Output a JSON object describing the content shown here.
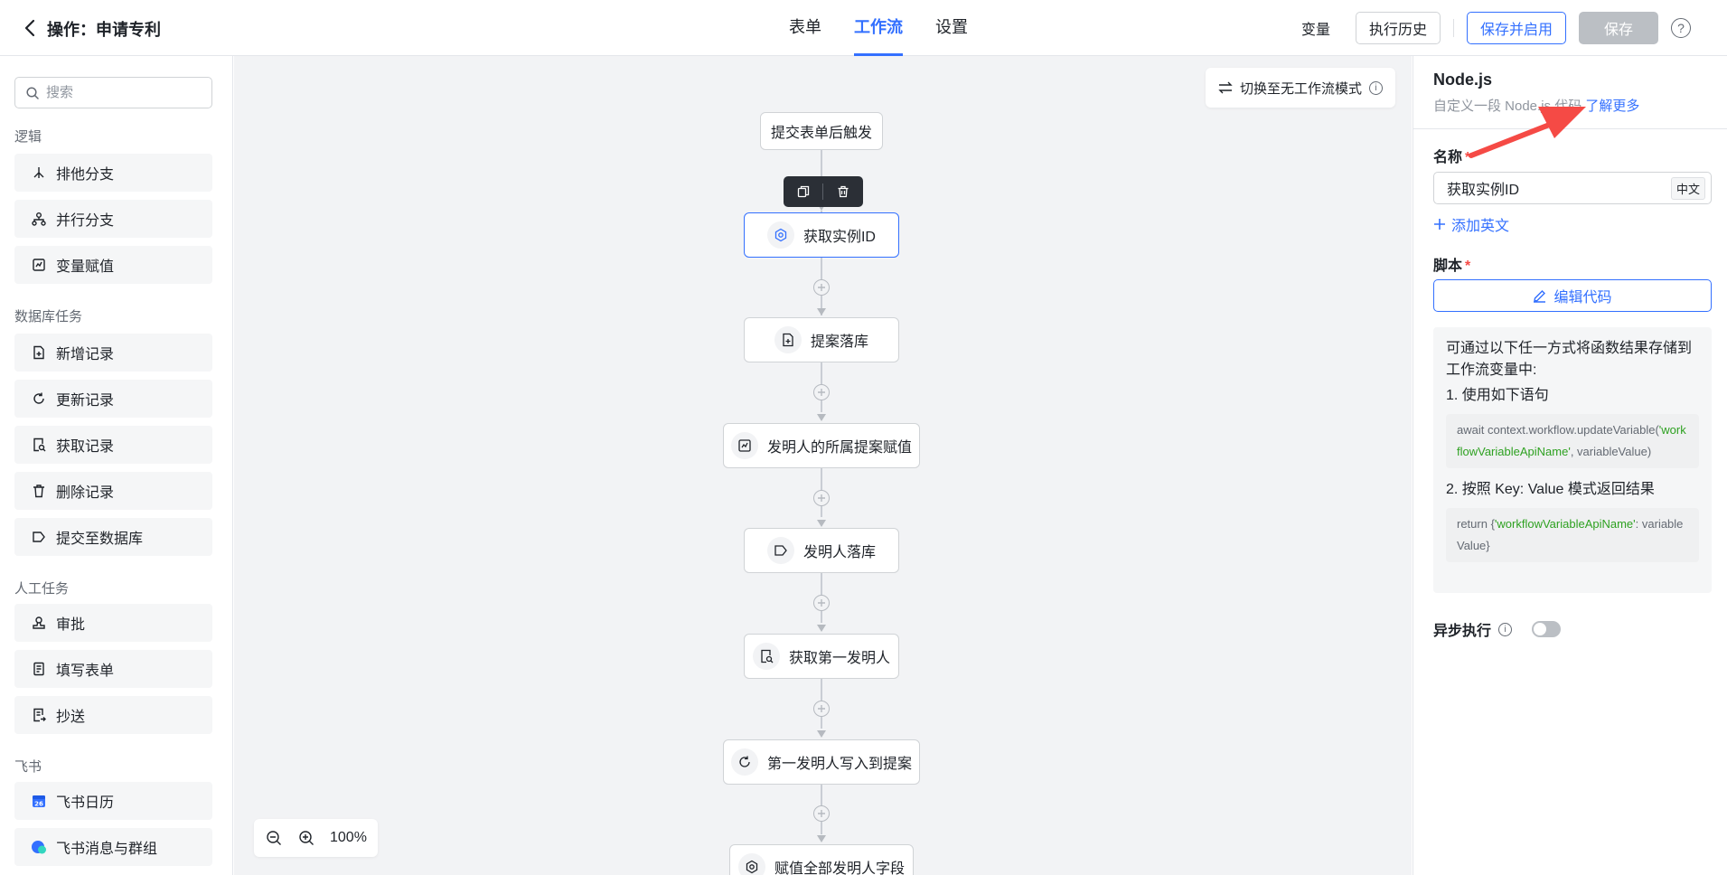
{
  "header": {
    "title": "操作：申请专利",
    "tabs": [
      {
        "label": "表单",
        "active": false
      },
      {
        "label": "工作流",
        "active": true
      },
      {
        "label": "设置",
        "active": false
      }
    ],
    "variables_label": "变量",
    "history_label": "执行历史",
    "save_enable_label": "保存并启用",
    "save_label": "保存",
    "help_icon": "?"
  },
  "sidebar": {
    "search_placeholder": "搜索",
    "sections": [
      {
        "title": "逻辑",
        "items": [
          {
            "label": "排他分支",
            "icon": "branch-icon"
          },
          {
            "label": "并行分支",
            "icon": "parallel-icon"
          },
          {
            "label": "变量赋值",
            "icon": "assign-icon"
          }
        ]
      },
      {
        "title": "数据库任务",
        "items": [
          {
            "label": "新增记录",
            "icon": "add-record-icon"
          },
          {
            "label": "更新记录",
            "icon": "refresh-icon"
          },
          {
            "label": "获取记录",
            "icon": "get-record-icon"
          },
          {
            "label": "删除记录",
            "icon": "trash-icon"
          },
          {
            "label": "提交至数据库",
            "icon": "tag-icon"
          }
        ]
      },
      {
        "title": "人工任务",
        "items": [
          {
            "label": "审批",
            "icon": "approve-icon"
          },
          {
            "label": "填写表单",
            "icon": "form-icon"
          },
          {
            "label": "抄送",
            "icon": "cc-icon"
          }
        ]
      },
      {
        "title": "飞书",
        "items": [
          {
            "label": "飞书日历",
            "icon": "calendar-icon"
          },
          {
            "label": "飞书消息与群组",
            "icon": "message-icon"
          }
        ]
      }
    ]
  },
  "canvas": {
    "switch_label": "切换至无工作流模式",
    "trigger_label": "提交表单后触发",
    "nodes": [
      {
        "label": "获取实例ID",
        "icon": "nodejs-icon"
      },
      {
        "label": "提案落库",
        "icon": "add-record-icon"
      },
      {
        "label": "发明人的所属提案赋值",
        "icon": "assign-icon"
      },
      {
        "label": "发明人落库",
        "icon": "tag-icon"
      },
      {
        "label": "获取第一发明人",
        "icon": "get-record-icon"
      },
      {
        "label": "第一发明人写入到提案",
        "icon": "refresh-icon"
      },
      {
        "label": "赋值全部发明人字段",
        "icon": "nodejs-icon"
      }
    ],
    "zoom_level": "100%"
  },
  "panel": {
    "title": "Node.js",
    "description": "自定义一段 Node.js 代码",
    "learn_more": "了解更多",
    "name_label": "名称",
    "name_value": "获取实例ID",
    "lang_tag": "中文",
    "add_english": "添加英文",
    "script_label": "脚本",
    "required_mark": "*",
    "edit_code": "编辑代码",
    "info_intro": "可通过以下任一方式将函数结果存储到工作流变量中:",
    "method1": "1. 使用如下语句",
    "code1_pre": "await context.workflow.updateVariable(",
    "code1_str": "'workflowVariableApiName'",
    "code1_post": ", variableValue)",
    "method2": "2. 按照 Key: Value 模式返回结果",
    "code2_pre": "return {",
    "code2_str": "'workflowVariableApiName'",
    "code2_post": ": variableValue}",
    "async_label": "异步执行",
    "async_enabled": false
  },
  "colors": {
    "accent": "#3370ff",
    "canvas_bg": "#f2f3f5",
    "annotation_arrow": "#f54a45",
    "code_string": "#2ea121"
  }
}
